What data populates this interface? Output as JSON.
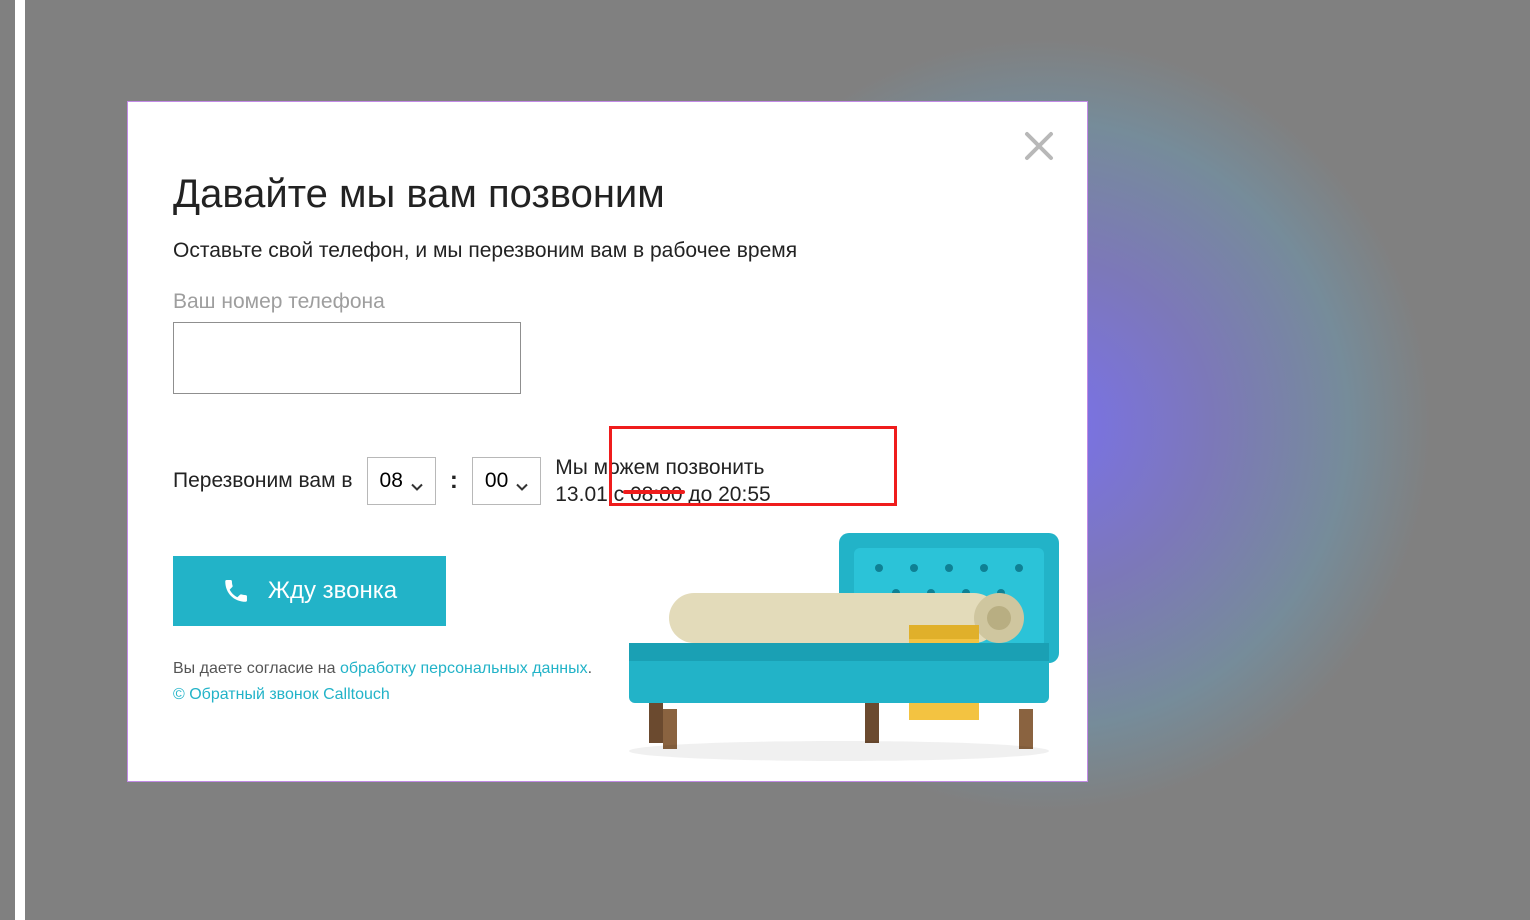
{
  "modal": {
    "title": "Давайте мы вам позвоним",
    "subtitle": "Оставьте свой телефон, и мы перезвоним вам в рабочее время",
    "phone_field_label": "Ваш номер телефона",
    "phone_value": "",
    "callback_label": "Перезвоним вам в",
    "time_hour": "08",
    "time_minute": "00",
    "time_colon": ":",
    "hint_line1": "Мы можем позвонить",
    "hint_line2": "13.01 с 08:00 до 20:55",
    "cta_label": "Жду звонка",
    "consent_prefix": "Вы даете согласие на ",
    "consent_link": "обработку персональных данных",
    "consent_suffix": ".",
    "credit_link": "© Обратный звонок Calltouch"
  },
  "colors": {
    "accent": "#22b3c8",
    "highlight": "#ef1c1c"
  }
}
